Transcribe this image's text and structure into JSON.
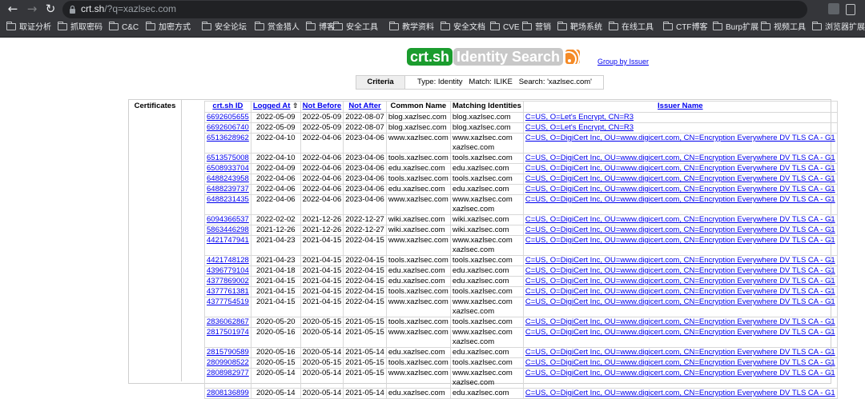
{
  "browser": {
    "url_host": "crt.sh",
    "url_rest": "/?q=xazlsec.com",
    "bookmarks": [
      "取证分析",
      "抓取密码",
      "C&C",
      "加密方式",
      "安全论坛",
      "赏金猎人",
      "博客",
      "安全工具",
      "教学资料",
      "安全文档",
      "CVE",
      "营销",
      "靶场系统",
      "在线工具",
      "CTF博客",
      "Burp扩展",
      "视频工具",
      "浏览器扩展"
    ]
  },
  "header": {
    "logo": "crt.sh",
    "subtitle": "Identity Search",
    "group_link": "Group by Issuer"
  },
  "criteria": {
    "label": "Criteria",
    "value": "Type: Identity   Match: ILIKE   Search: 'xazlsec.com'"
  },
  "results": {
    "section_label": "Certificates",
    "columns": [
      "crt.sh ID",
      "Logged At",
      "Not Before",
      "Not After",
      "Common Name",
      "Matching Identities",
      "Issuer Name"
    ],
    "sort_indicator": "⇧",
    "rows": [
      {
        "id": "6692605655",
        "logged": "2022-05-09",
        "nb": "2022-05-09",
        "na": "2022-08-07",
        "cn": "blog.xazlsec.com",
        "mi": "blog.xazlsec.com",
        "issuer": "C=US, O=Let's Encrypt, CN=R3"
      },
      {
        "id": "6692606740",
        "logged": "2022-05-09",
        "nb": "2022-05-09",
        "na": "2022-08-07",
        "cn": "blog.xazlsec.com",
        "mi": "blog.xazlsec.com",
        "issuer": "C=US, O=Let's Encrypt, CN=R3"
      },
      {
        "id": "6513628962",
        "logged": "2022-04-10",
        "nb": "2022-04-06",
        "na": "2023-04-06",
        "cn": "www.xazlsec.com",
        "mi": "www.xazlsec.com",
        "mi2": "xazlsec.com",
        "issuer": "C=US, O=DigiCert Inc, OU=www.digicert.com, CN=Encryption Everywhere DV TLS CA - G1"
      },
      {
        "id": "6513575008",
        "logged": "2022-04-10",
        "nb": "2022-04-06",
        "na": "2023-04-06",
        "cn": "tools.xazlsec.com",
        "mi": "tools.xazlsec.com",
        "issuer": "C=US, O=DigiCert Inc, OU=www.digicert.com, CN=Encryption Everywhere DV TLS CA - G1"
      },
      {
        "id": "6508933704",
        "logged": "2022-04-09",
        "nb": "2022-04-06",
        "na": "2023-04-06",
        "cn": "edu.xazlsec.com",
        "mi": "edu.xazlsec.com",
        "issuer": "C=US, O=DigiCert Inc, OU=www.digicert.com, CN=Encryption Everywhere DV TLS CA - G1"
      },
      {
        "id": "6488243958",
        "logged": "2022-04-06",
        "nb": "2022-04-06",
        "na": "2023-04-06",
        "cn": "tools.xazlsec.com",
        "mi": "tools.xazlsec.com",
        "issuer": "C=US, O=DigiCert Inc, OU=www.digicert.com, CN=Encryption Everywhere DV TLS CA - G1"
      },
      {
        "id": "6488239737",
        "logged": "2022-04-06",
        "nb": "2022-04-06",
        "na": "2023-04-06",
        "cn": "edu.xazlsec.com",
        "mi": "edu.xazlsec.com",
        "issuer": "C=US, O=DigiCert Inc, OU=www.digicert.com, CN=Encryption Everywhere DV TLS CA - G1"
      },
      {
        "id": "6488231435",
        "logged": "2022-04-06",
        "nb": "2022-04-06",
        "na": "2023-04-06",
        "cn": "www.xazlsec.com",
        "mi": "www.xazlsec.com",
        "mi2": "xazlsec.com",
        "issuer": "C=US, O=DigiCert Inc, OU=www.digicert.com, CN=Encryption Everywhere DV TLS CA - G1"
      },
      {
        "id": "6094366537",
        "logged": "2022-02-02",
        "nb": "2021-12-26",
        "na": "2022-12-27",
        "cn": "wiki.xazlsec.com",
        "mi": "wiki.xazlsec.com",
        "issuer": "C=US, O=DigiCert Inc, OU=www.digicert.com, CN=Encryption Everywhere DV TLS CA - G1"
      },
      {
        "id": "5863446298",
        "logged": "2021-12-26",
        "nb": "2021-12-26",
        "na": "2022-12-27",
        "cn": "wiki.xazlsec.com",
        "mi": "wiki.xazlsec.com",
        "issuer": "C=US, O=DigiCert Inc, OU=www.digicert.com, CN=Encryption Everywhere DV TLS CA - G1"
      },
      {
        "id": "4421747941",
        "logged": "2021-04-23",
        "nb": "2021-04-15",
        "na": "2022-04-15",
        "cn": "www.xazlsec.com",
        "mi": "www.xazlsec.com",
        "mi2": "xazlsec.com",
        "issuer": "C=US, O=DigiCert Inc, OU=www.digicert.com, CN=Encryption Everywhere DV TLS CA - G1"
      },
      {
        "id": "4421748128",
        "logged": "2021-04-23",
        "nb": "2021-04-15",
        "na": "2022-04-15",
        "cn": "tools.xazlsec.com",
        "mi": "tools.xazlsec.com",
        "issuer": "C=US, O=DigiCert Inc, OU=www.digicert.com, CN=Encryption Everywhere DV TLS CA - G1"
      },
      {
        "id": "4396779104",
        "logged": "2021-04-18",
        "nb": "2021-04-15",
        "na": "2022-04-15",
        "cn": "edu.xazlsec.com",
        "mi": "edu.xazlsec.com",
        "issuer": "C=US, O=DigiCert Inc, OU=www.digicert.com, CN=Encryption Everywhere DV TLS CA - G1"
      },
      {
        "id": "4377869002",
        "logged": "2021-04-15",
        "nb": "2021-04-15",
        "na": "2022-04-15",
        "cn": "edu.xazlsec.com",
        "mi": "edu.xazlsec.com",
        "issuer": "C=US, O=DigiCert Inc, OU=www.digicert.com, CN=Encryption Everywhere DV TLS CA - G1"
      },
      {
        "id": "4377761381",
        "logged": "2021-04-15",
        "nb": "2021-04-15",
        "na": "2022-04-15",
        "cn": "tools.xazlsec.com",
        "mi": "tools.xazlsec.com",
        "issuer": "C=US, O=DigiCert Inc, OU=www.digicert.com, CN=Encryption Everywhere DV TLS CA - G1"
      },
      {
        "id": "4377754519",
        "logged": "2021-04-15",
        "nb": "2021-04-15",
        "na": "2022-04-15",
        "cn": "www.xazlsec.com",
        "mi": "www.xazlsec.com",
        "mi2": "xazlsec.com",
        "issuer": "C=US, O=DigiCert Inc, OU=www.digicert.com, CN=Encryption Everywhere DV TLS CA - G1"
      },
      {
        "id": "2836062867",
        "logged": "2020-05-20",
        "nb": "2020-05-15",
        "na": "2021-05-15",
        "cn": "tools.xazlsec.com",
        "mi": "tools.xazlsec.com",
        "issuer": "C=US, O=DigiCert Inc, OU=www.digicert.com, CN=Encryption Everywhere DV TLS CA - G1"
      },
      {
        "id": "2817501974",
        "logged": "2020-05-16",
        "nb": "2020-05-14",
        "na": "2021-05-15",
        "cn": "www.xazlsec.com",
        "mi": "www.xazlsec.com",
        "mi2": "xazlsec.com",
        "issuer": "C=US, O=DigiCert Inc, OU=www.digicert.com, CN=Encryption Everywhere DV TLS CA - G1"
      },
      {
        "id": "2815790589",
        "logged": "2020-05-16",
        "nb": "2020-05-14",
        "na": "2021-05-14",
        "cn": "edu.xazlsec.com",
        "mi": "edu.xazlsec.com",
        "issuer": "C=US, O=DigiCert Inc, OU=www.digicert.com, CN=Encryption Everywhere DV TLS CA - G1"
      },
      {
        "id": "2809908522",
        "logged": "2020-05-15",
        "nb": "2020-05-15",
        "na": "2021-05-15",
        "cn": "tools.xazlsec.com",
        "mi": "tools.xazlsec.com",
        "issuer": "C=US, O=DigiCert Inc, OU=www.digicert.com, CN=Encryption Everywhere DV TLS CA - G1"
      },
      {
        "id": "2808982977",
        "logged": "2020-05-14",
        "nb": "2020-05-14",
        "na": "2021-05-15",
        "cn": "www.xazlsec.com",
        "mi": "www.xazlsec.com",
        "mi2": "xazlsec.com",
        "issuer": "C=US, O=DigiCert Inc, OU=www.digicert.com, CN=Encryption Everywhere DV TLS CA - G1"
      },
      {
        "id": "2808136899",
        "logged": "2020-05-14",
        "nb": "2020-05-14",
        "na": "2021-05-14",
        "cn": "edu.xazlsec.com",
        "mi": "edu.xazlsec.com",
        "issuer": "C=US, O=DigiCert Inc, OU=www.digicert.com, CN=Encryption Everywhere DV TLS CA - G1"
      }
    ]
  }
}
